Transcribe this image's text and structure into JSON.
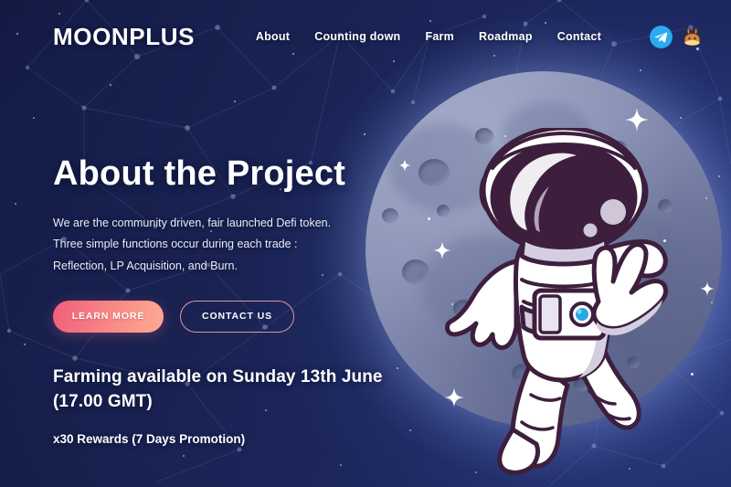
{
  "theme": {
    "background_navy": "#161f4e",
    "accent_pink": "#f05f79",
    "accent_peach": "#fca793",
    "outline_pink": "#e4939c",
    "moon_gray": "#8890b4",
    "telegram_blue": "#2aabee",
    "suit_outline": "#3d1f3d",
    "panel_blue": "#29a9e0"
  },
  "header": {
    "logo": "MOONPLUS",
    "nav": [
      {
        "label": "About",
        "name": "nav-link-about"
      },
      {
        "label": "Counting down",
        "name": "nav-link-counting-down"
      },
      {
        "label": "Farm",
        "name": "nav-link-farm"
      },
      {
        "label": "Roadmap",
        "name": "nav-link-roadmap"
      },
      {
        "label": "Contact",
        "name": "nav-link-contact"
      }
    ],
    "socials": [
      {
        "icon": "telegram-icon",
        "label": "Telegram"
      },
      {
        "icon": "pancakeswap-bunny-icon",
        "label": "PancakeSwap"
      }
    ]
  },
  "hero": {
    "title": "About the Project",
    "paragraph": {
      "line1": "We are the community driven, fair launched Defi token.",
      "line2": "Three simple functions occur during each trade :",
      "line3": "Reflection, LP Acquisition, and Burn."
    },
    "buttons": {
      "primary": "LEARN MORE",
      "secondary": "CONTACT US"
    },
    "promo": {
      "headline_line1": "Farming available on Sunday 13th June",
      "headline_line2": "(17.00 GMT)",
      "subline": "x30 Rewards (7 Days Promotion)"
    }
  },
  "illustration": {
    "moon": "moon-graphic",
    "character": "astronaut-peace-sign-illustration",
    "stars": "star-field"
  }
}
